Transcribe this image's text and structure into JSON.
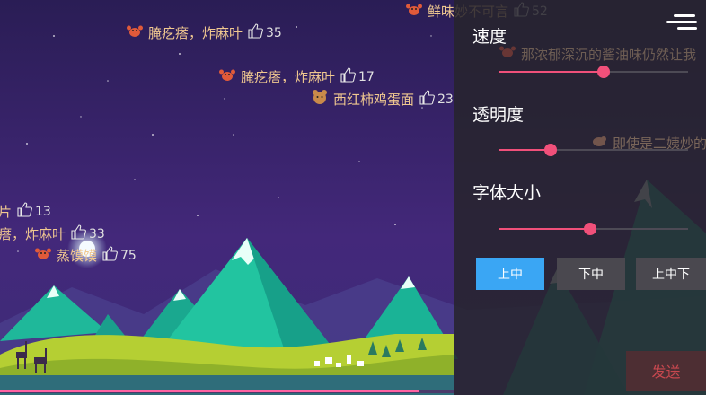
{
  "danmaku": [
    {
      "emoji": "crab",
      "text": "鲜味妙不可言",
      "likes": "52"
    },
    {
      "emoji": "crab",
      "text": "腌疙瘩，炸麻叶",
      "likes": "35"
    },
    {
      "emoji": "crab",
      "text": "腌疙瘩，炸麻叶",
      "likes": "17"
    },
    {
      "emoji": "bear",
      "text": "西红柿鸡蛋面",
      "likes": "23"
    },
    {
      "emoji": "none",
      "text": "片",
      "likes": "13"
    },
    {
      "emoji": "none",
      "text": "瘩，炸麻叶",
      "likes": "33"
    },
    {
      "emoji": "crab",
      "text": "蒸馍馍",
      "likes": "75"
    },
    {
      "emoji": "crab",
      "text": "那浓郁深沉的酱油味仍然让我",
      "likes": ""
    },
    {
      "emoji": "bird",
      "text": "即使是二姨炒的",
      "likes": ""
    }
  ],
  "settings": {
    "speed": {
      "label": "速度",
      "value": 0.55
    },
    "opacity": {
      "label": "透明度",
      "value": 0.27
    },
    "font_size": {
      "label": "字体大小",
      "value": 0.48
    }
  },
  "position_buttons": [
    {
      "label": "上中",
      "active": true
    },
    {
      "label": "下中",
      "active": false
    },
    {
      "label": "上中下",
      "active": false
    }
  ],
  "send_label": "发送",
  "progress": 0.92,
  "colors": {
    "accent": "#f0507a",
    "active_button": "#3aa6f4",
    "danmaku_text": "#f0c890"
  }
}
